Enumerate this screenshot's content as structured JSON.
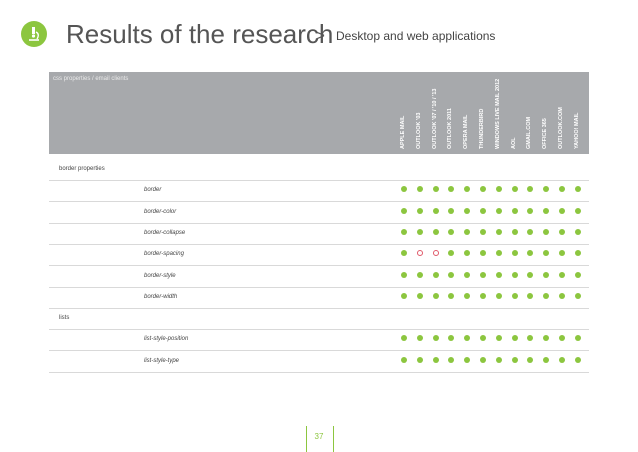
{
  "header": {
    "title": "Results of the research",
    "separator": ">",
    "subtitle": "Desktop and web applications"
  },
  "table": {
    "caption": "css properties / email clients",
    "columns": [
      "APPLE MAIL",
      "OUTLOOK '03",
      "OUTLOOK '07 / '10 / '13",
      "OUTLOOK 2011",
      "OPERA MAIL",
      "THUNDERBIRD",
      "WINDOWS LIVE MAIL 2012",
      "AOL",
      "GMAIL.COM",
      "OFFICE 365",
      "OUTLOOK.COM",
      "YAHOO! MAIL"
    ],
    "rows": [
      {
        "type": "group",
        "label": "border properties"
      },
      {
        "type": "prop",
        "label": "border",
        "support": [
          "yes",
          "yes",
          "yes",
          "yes",
          "yes",
          "yes",
          "yes",
          "yes",
          "yes",
          "yes",
          "yes",
          "yes"
        ]
      },
      {
        "type": "prop",
        "label": "border-color",
        "support": [
          "yes",
          "yes",
          "yes",
          "yes",
          "yes",
          "yes",
          "yes",
          "yes",
          "yes",
          "yes",
          "yes",
          "yes"
        ]
      },
      {
        "type": "prop",
        "label": "border-collapse",
        "support": [
          "yes",
          "yes",
          "yes",
          "yes",
          "yes",
          "yes",
          "yes",
          "yes",
          "yes",
          "yes",
          "yes",
          "yes"
        ]
      },
      {
        "type": "prop",
        "label": "border-spacing",
        "support": [
          "yes",
          "partial",
          "partial",
          "yes",
          "yes",
          "yes",
          "yes",
          "yes",
          "yes",
          "yes",
          "yes",
          "yes"
        ]
      },
      {
        "type": "prop",
        "label": "border-style",
        "support": [
          "yes",
          "yes",
          "yes",
          "yes",
          "yes",
          "yes",
          "yes",
          "yes",
          "yes",
          "yes",
          "yes",
          "yes"
        ]
      },
      {
        "type": "prop",
        "label": "border-width",
        "support": [
          "yes",
          "yes",
          "yes",
          "yes",
          "yes",
          "yes",
          "yes",
          "yes",
          "yes",
          "yes",
          "yes",
          "yes"
        ]
      },
      {
        "type": "group",
        "label": "lists"
      },
      {
        "type": "prop",
        "label": "list-style-position",
        "support": [
          "yes",
          "yes",
          "yes",
          "yes",
          "yes",
          "yes",
          "yes",
          "yes",
          "yes",
          "yes",
          "yes",
          "yes"
        ]
      },
      {
        "type": "prop",
        "label": "list-style-type",
        "support": [
          "yes",
          "yes",
          "yes",
          "yes",
          "yes",
          "yes",
          "yes",
          "yes",
          "yes",
          "yes",
          "yes",
          "yes"
        ]
      }
    ]
  },
  "colors": {
    "accent": "#8cc63f",
    "partial": "#e05a6a",
    "header_bg": "#a7a9ac"
  },
  "logo_icon": "microscope-icon",
  "page_number": "37"
}
